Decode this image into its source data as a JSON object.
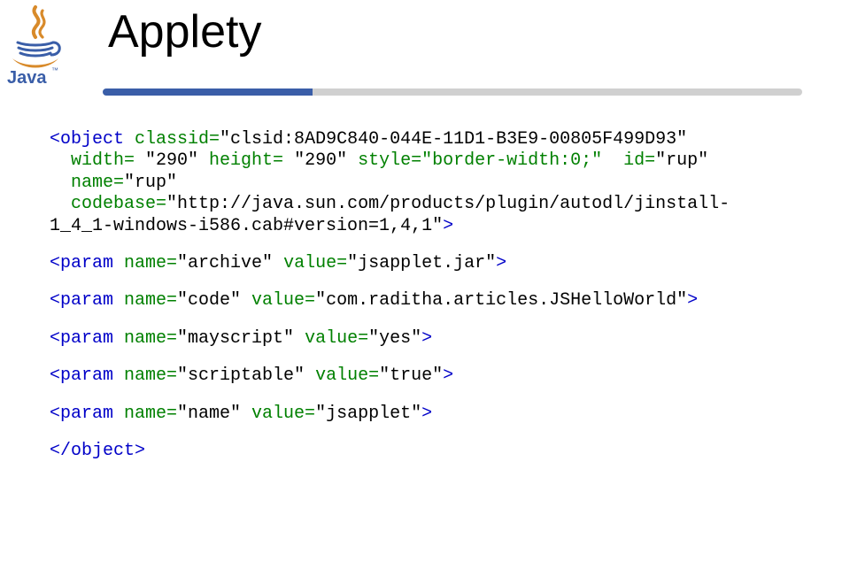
{
  "title": "Applety",
  "logo": {
    "word": "Java",
    "tm": "™",
    "colors": {
      "java_text": "#3a5ea8",
      "steam": "#d88a2a",
      "cup": "#3a5ea8",
      "saucer": "#d88a2a"
    }
  },
  "code": {
    "l1a": "<object",
    "l1b": " classid=",
    "l1c": "\"clsid:8AD9C840-044E-11D1-B3E9-00805F499D93\"",
    "l2a": "  width= ",
    "l2b": "\"290\"",
    "l2c": " height= ",
    "l2d": "\"290\"",
    "l2e": " style=\"border-width:0;\"  id=",
    "l2f": "\"rup\"",
    "l3a": "  name=",
    "l3b": "\"rup\"",
    "l4a": "  codebase=",
    "l4b": "\"http://java.sun.com/products/plugin/autodl/jinstall-",
    "l5a": "1_4_1-windows-i586.cab#version=1,4,1\"",
    "l5b": ">",
    "p1a": "<param",
    "p1b": " name=",
    "p1c": "\"archive\"",
    "p1d": " value=",
    "p1e": "\"jsapplet.jar\"",
    "p1f": ">",
    "p2a": "<param",
    "p2b": " name=",
    "p2c": "\"code\"",
    "p2d": " value=",
    "p2e": "\"com.raditha.articles.JSHelloWorld\"",
    "p2f": ">",
    "p3a": "<param",
    "p3b": " name=",
    "p3c": "\"mayscript\"",
    "p3d": " value=",
    "p3e": "\"yes\"",
    "p3f": ">",
    "p4a": "<param",
    "p4b": " name=",
    "p4c": "\"scriptable\"",
    "p4d": " value=",
    "p4e": "\"true\"",
    "p4f": ">",
    "p5a": "<param",
    "p5b": " name=",
    "p5c": "\"name\"",
    "p5d": " value=",
    "p5e": "\"jsapplet\"",
    "p5f": ">",
    "end": "</object>"
  }
}
